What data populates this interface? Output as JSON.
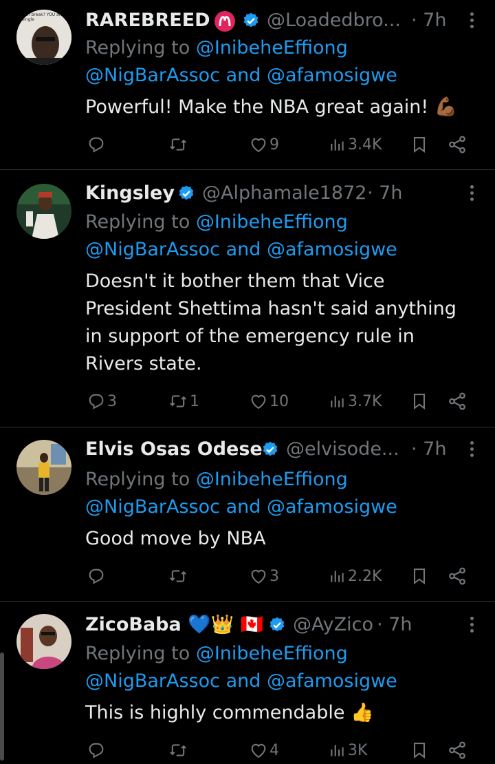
{
  "tweets": [
    {
      "name": "RAREBREED",
      "handle": "@Loadedbro...",
      "time": "· 7h",
      "replying_prefix": "Replying to",
      "replying_first": "@InibeheEffiong",
      "replying_second_a": "@NigBarAssoc",
      "replying_and": "and",
      "replying_second_b": "@afamosigwe",
      "text_lines": [
        "Powerful! Make the NBA great again! 💪🏾"
      ],
      "replies": "",
      "retweets": "",
      "likes": "9",
      "views": "3.4K",
      "avatar_caption": "Can break? YOU are single"
    },
    {
      "name": "Kingsley",
      "handle": "@Alphamale1872",
      "time": "· 7h",
      "replying_prefix": "Replying to",
      "replying_first": "@InibeheEffiong",
      "replying_second_a": "@NigBarAssoc",
      "replying_and": "and",
      "replying_second_b": "@afamosigwe",
      "text_lines": [
        "Doesn't it bother them that Vice",
        "President Shettima hasn't said anything",
        "in support of the emergency rule in",
        "Rivers state."
      ],
      "replies": "3",
      "retweets": "1",
      "likes": "10",
      "views": "3.7K"
    },
    {
      "name": "Elvis Osas Odese",
      "handle": "@elvisode...",
      "time": "· 7h",
      "replying_prefix": "Replying to",
      "replying_first": "@InibeheEffiong",
      "replying_second_a": "@NigBarAssoc",
      "replying_and": "and",
      "replying_second_b": "@afamosigwe",
      "text_lines": [
        "Good move by NBA"
      ],
      "replies": "",
      "retweets": "",
      "likes": "3",
      "views": "2.2K"
    },
    {
      "name": "ZicoBaba 💙👑 🇨🇦",
      "handle": "@AyZico",
      "time": "· 7h",
      "replying_prefix": "Replying to",
      "replying_first": "@InibeheEffiong",
      "replying_second_a": "@NigBarAssoc",
      "replying_and": "and",
      "replying_second_b": "@afamosigwe",
      "text_lines": [
        "This is highly commendable 👍"
      ],
      "replies": "",
      "retweets": "",
      "likes": "4",
      "views": "3K"
    }
  ],
  "colors": {
    "background": "#000000",
    "text": "#e7e9ea",
    "muted": "#71767b",
    "link": "#1d9bf0",
    "verified": "#1d9bf0"
  },
  "icons": [
    "reply-icon",
    "retweet-icon",
    "like-icon",
    "views-icon",
    "bookmark-icon",
    "share-icon",
    "verified-icon",
    "more-icon"
  ]
}
